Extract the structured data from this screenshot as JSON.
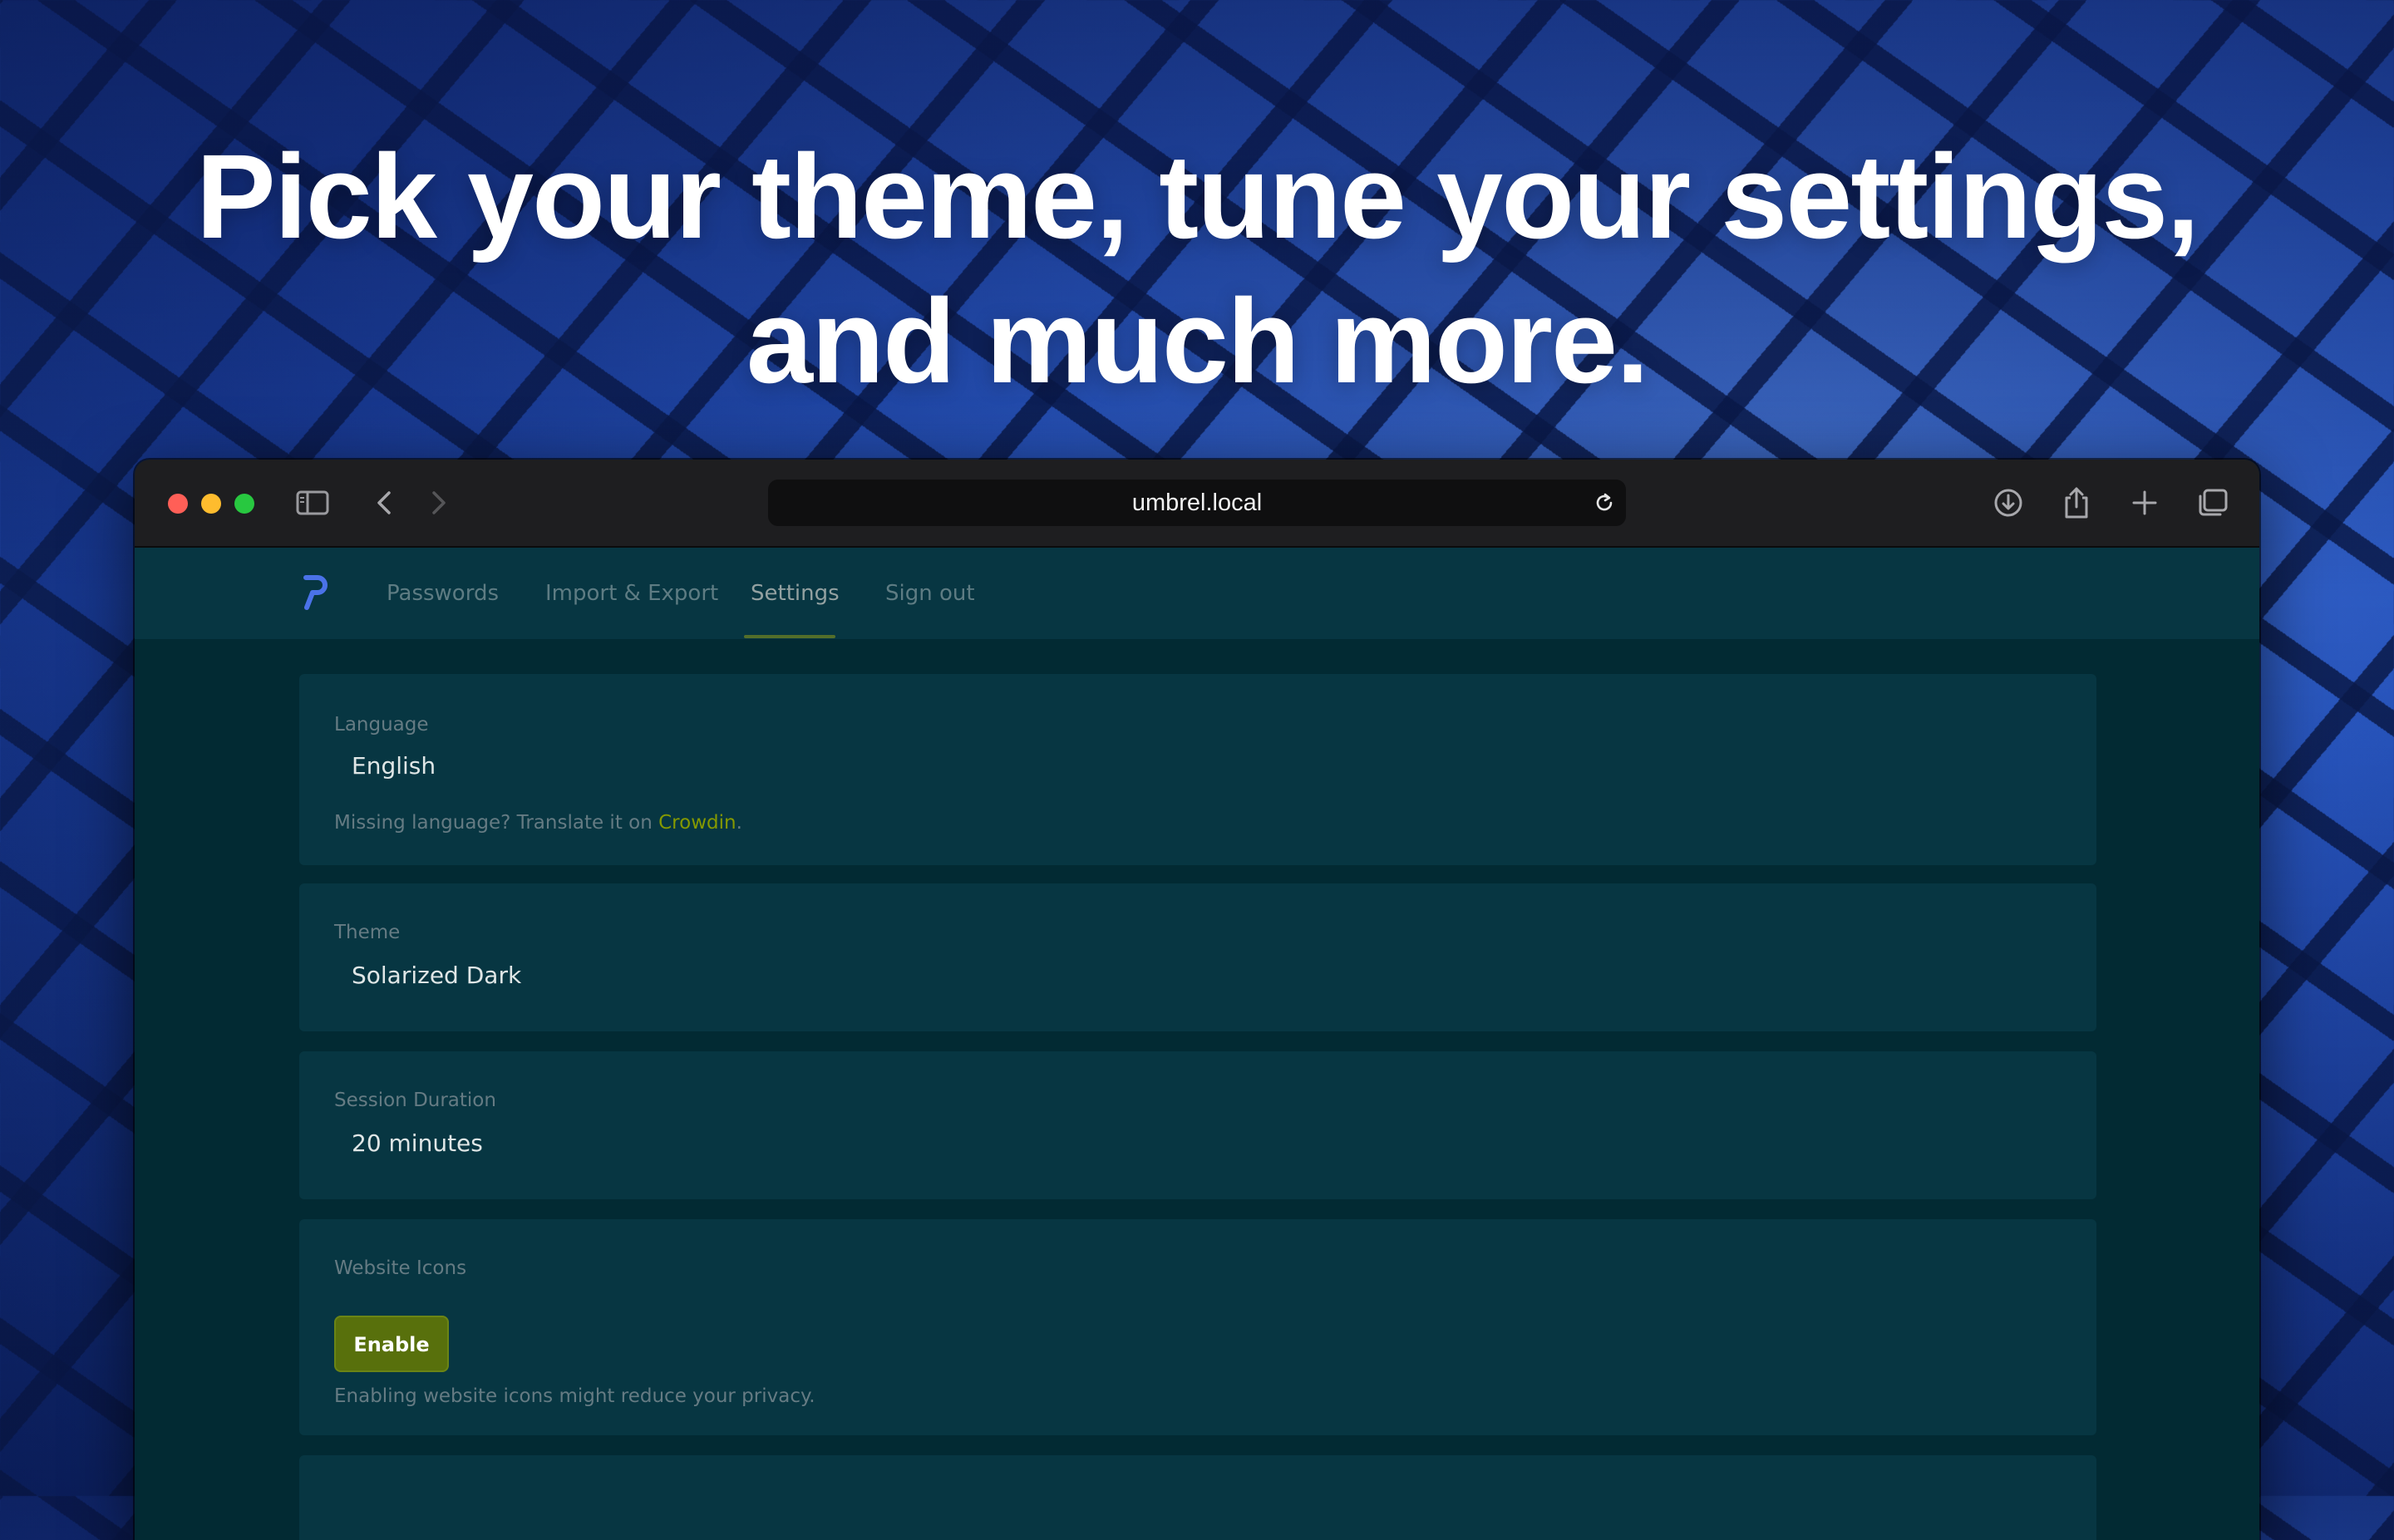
{
  "headline": {
    "line1": "Pick your theme, tune your settings,",
    "line2": "and much more."
  },
  "browser": {
    "url": "umbrel.local",
    "icons": [
      "sidebar-icon",
      "back-icon",
      "forward-icon",
      "reload-icon",
      "download-icon",
      "share-icon",
      "new-tab-icon",
      "tab-overview-icon"
    ]
  },
  "nav": {
    "items": [
      {
        "label": "Passwords"
      },
      {
        "label": "Import & Export"
      },
      {
        "label": "Settings"
      },
      {
        "label": "Sign out"
      }
    ],
    "active": "Settings",
    "accent_color": "#859900"
  },
  "settings": {
    "language": {
      "label": "Language",
      "value": "English",
      "help_prefix": "Missing language? Translate it on ",
      "help_link": "Crowdin",
      "help_suffix": "."
    },
    "theme": {
      "label": "Theme",
      "value": "Solarized Dark"
    },
    "session": {
      "label": "Session Duration",
      "value": "20 minutes"
    },
    "icons": {
      "label": "Website Icons",
      "button": "Enable",
      "help": "Enabling website icons might reduce your privacy."
    }
  },
  "colors": {
    "background": "#002b36",
    "card": "#073642",
    "button": "#58700c"
  }
}
